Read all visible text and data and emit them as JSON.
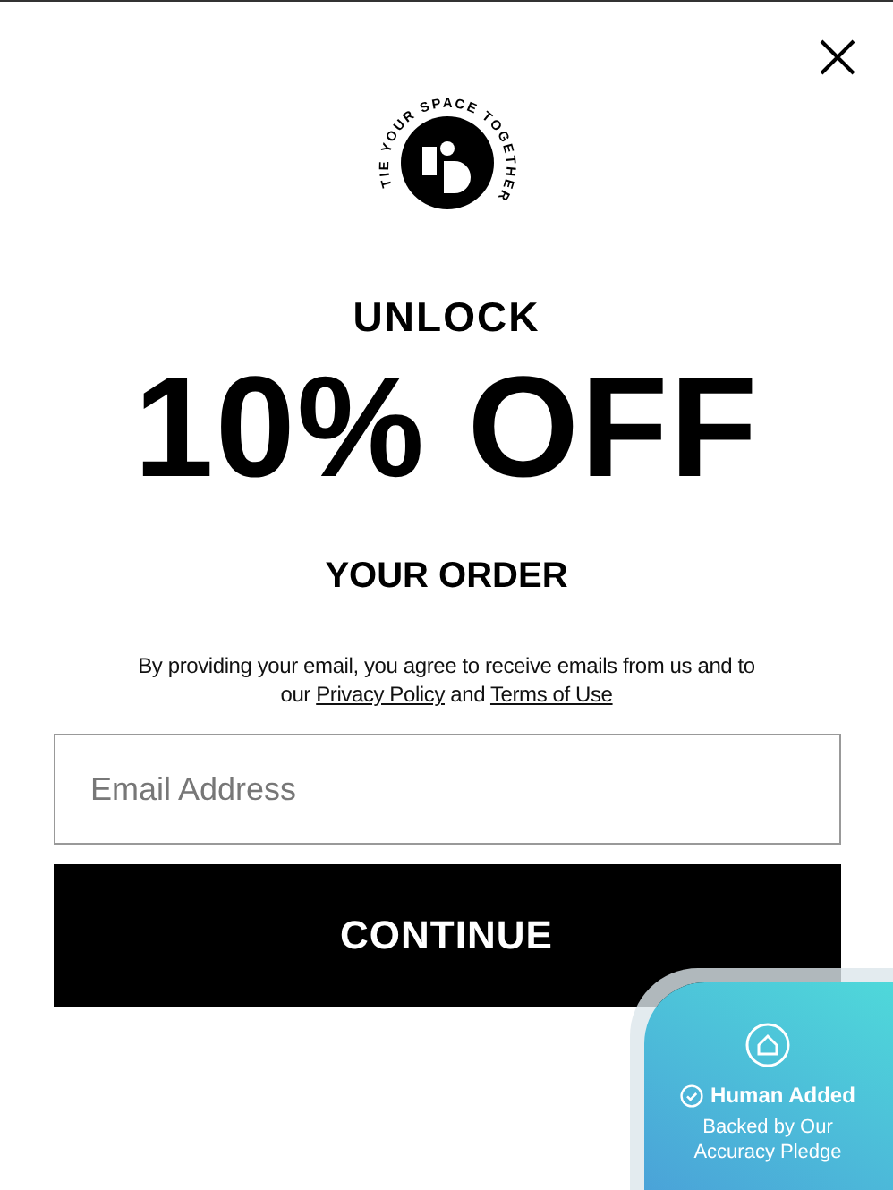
{
  "logo": {
    "tagline": "TIE YOUR SPACE TOGETHER"
  },
  "headline": {
    "pre": "UNLOCK",
    "main": "10% OFF",
    "post": "YOUR ORDER"
  },
  "consent": {
    "text": "By providing your email, you agree to receive emails from us and to our",
    "link_1": "Privacy Policy",
    "joiner": "and",
    "link_2": "Terms of Use"
  },
  "email_field": {
    "placeholder": "Email Address"
  },
  "continue_button": "CONTINUE",
  "badge": {
    "title": "Human Added",
    "subtitle": "Backed by Our Accuracy Pledge"
  }
}
